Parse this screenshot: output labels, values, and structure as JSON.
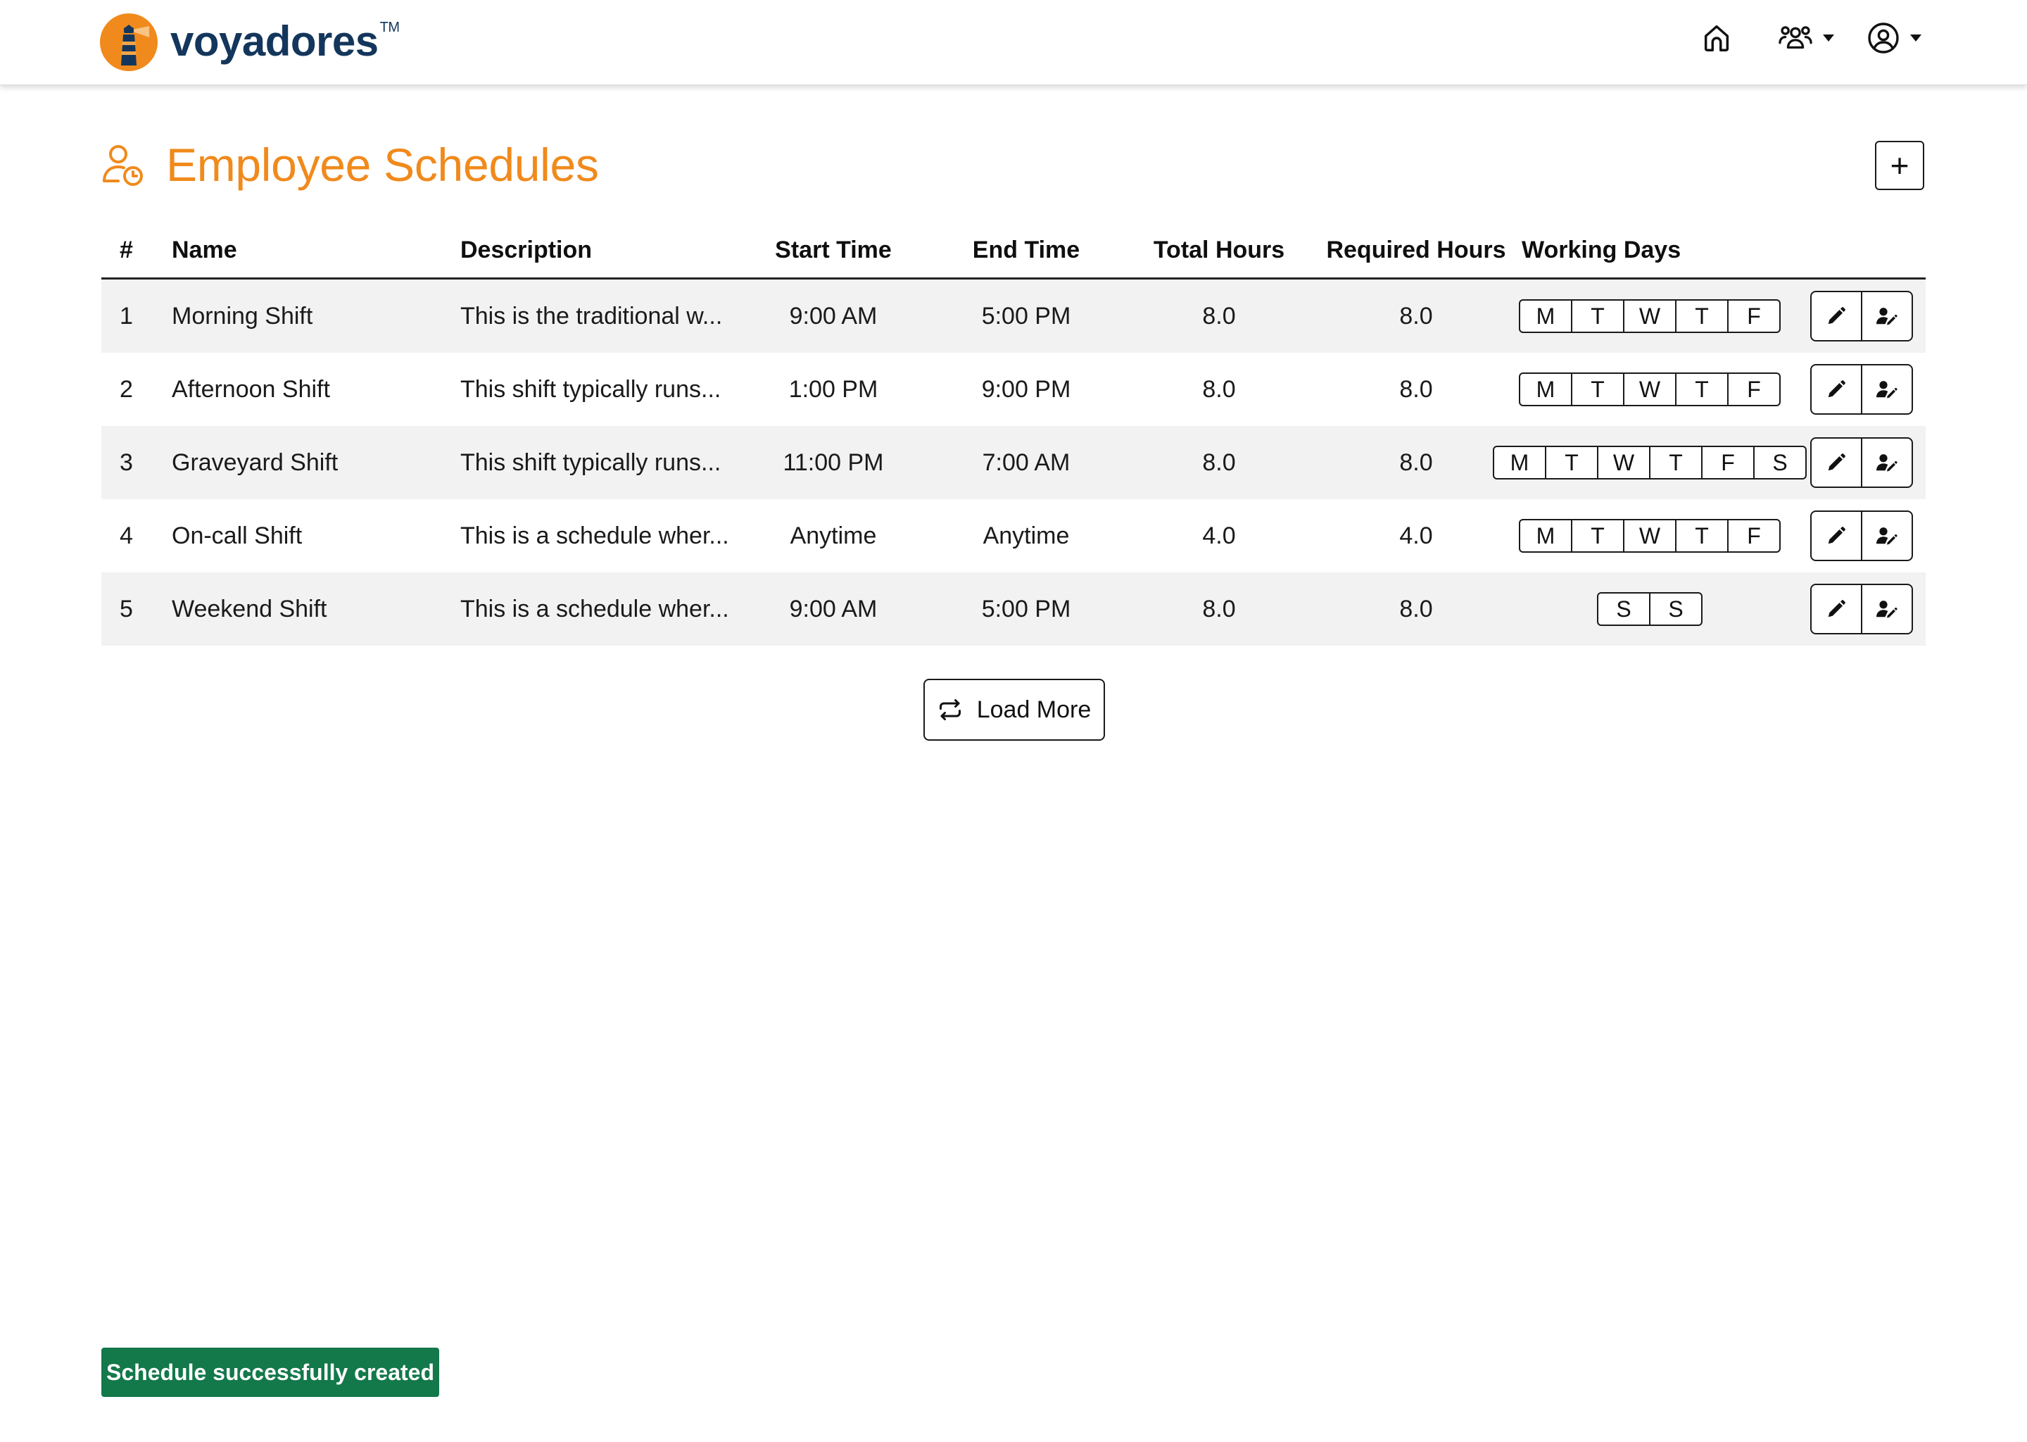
{
  "brand": {
    "name": "voyadores",
    "trademark": "TM",
    "colors": {
      "primary": "#14365c",
      "accent": "#f08a1c"
    }
  },
  "nav": {
    "home_icon": "home-icon",
    "team_icon": "users-icon",
    "account_icon": "user-circle-icon"
  },
  "page": {
    "title": "Employee Schedules",
    "title_icon": "user-clock-icon",
    "add_label": "+"
  },
  "table": {
    "columns": {
      "index": "#",
      "name": "Name",
      "description": "Description",
      "start": "Start Time",
      "end": "End Time",
      "total": "Total Hours",
      "required": "Required Hours",
      "days": "Working Days"
    },
    "rows": [
      {
        "index": "1",
        "name": "Morning Shift",
        "description": "This is the traditional w...",
        "start": "9:00 AM",
        "end": "5:00 PM",
        "total": "8.0",
        "required": "8.0",
        "days": [
          "M",
          "T",
          "W",
          "T",
          "F"
        ]
      },
      {
        "index": "2",
        "name": "Afternoon Shift",
        "description": "This shift typically runs...",
        "start": "1:00 PM",
        "end": "9:00 PM",
        "total": "8.0",
        "required": "8.0",
        "days": [
          "M",
          "T",
          "W",
          "T",
          "F"
        ]
      },
      {
        "index": "3",
        "name": "Graveyard Shift",
        "description": "This shift typically runs...",
        "start": "11:00 PM",
        "end": "7:00 AM",
        "total": "8.0",
        "required": "8.0",
        "days": [
          "M",
          "T",
          "W",
          "T",
          "F",
          "S"
        ]
      },
      {
        "index": "4",
        "name": "On-call Shift",
        "description": "This is a schedule wher...",
        "start": "Anytime",
        "end": "Anytime",
        "total": "4.0",
        "required": "4.0",
        "days": [
          "M",
          "T",
          "W",
          "T",
          "F"
        ]
      },
      {
        "index": "5",
        "name": "Weekend Shift",
        "description": "This is a schedule wher...",
        "start": "9:00 AM",
        "end": "5:00 PM",
        "total": "8.0",
        "required": "8.0",
        "days": [
          "S",
          "S"
        ]
      }
    ],
    "row_actions": {
      "edit_icon": "pencil-icon",
      "assign_icon": "user-edit-icon"
    }
  },
  "load_more": {
    "label": "Load More",
    "icon": "repeat-icon"
  },
  "toast": {
    "message": "Schedule successfully created",
    "color": "#13784a"
  }
}
